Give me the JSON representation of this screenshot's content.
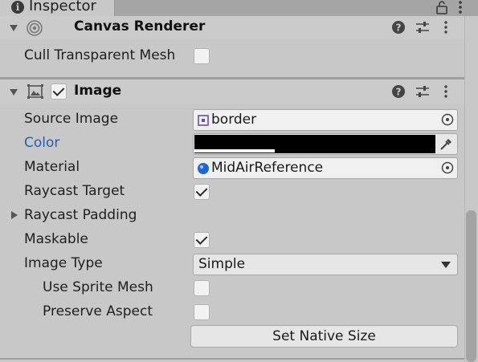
{
  "tab": {
    "title": "Inspector",
    "info_glyph": "i"
  },
  "canvas_renderer": {
    "title": "Canvas Renderer",
    "cull_label": "Cull Transparent Mesh",
    "cull_checked": false
  },
  "image": {
    "title": "Image",
    "enabled": true,
    "source_image_label": "Source Image",
    "source_image_value": "border",
    "color_label": "Color",
    "color_value": "#000000",
    "material_label": "Material",
    "material_value": "MidAirReference",
    "raycast_target_label": "Raycast Target",
    "raycast_target_checked": true,
    "raycast_padding_label": "Raycast Padding",
    "maskable_label": "Maskable",
    "maskable_checked": true,
    "image_type_label": "Image Type",
    "image_type_value": "Simple",
    "use_sprite_mesh_label": "Use Sprite Mesh",
    "use_sprite_mesh_checked": false,
    "preserve_aspect_label": "Preserve Aspect",
    "preserve_aspect_checked": false,
    "set_native_size_label": "Set Native Size"
  },
  "colors": {
    "accent_label": "#2a5fb0",
    "material_ball": "#1e66d0",
    "sprite_icon": "#6b4fa0"
  }
}
